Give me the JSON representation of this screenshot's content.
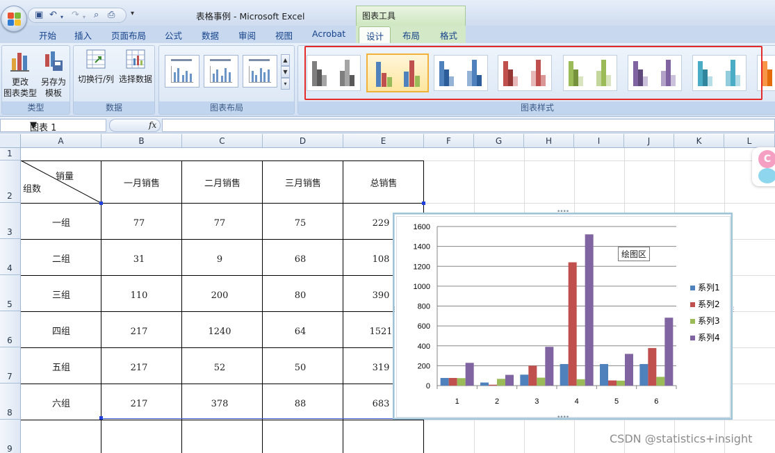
{
  "window": {
    "title": "表格事例 - Microsoft Excel",
    "context_tab_group": "图表工具"
  },
  "ribbon_tabs": [
    "开始",
    "插入",
    "页面布局",
    "公式",
    "数据",
    "审阅",
    "视图",
    "Acrobat",
    "设计",
    "布局",
    "格式"
  ],
  "active_tab": "设计",
  "ribbon_groups": {
    "type": {
      "label": "类型",
      "change_chart_type": "更改\n图表类型",
      "save_as_template": "另存为\n模板"
    },
    "data": {
      "label": "数据",
      "switch_row_col": "切换行/列",
      "select_data": "选择数据"
    },
    "layout": {
      "label": "图表布局"
    },
    "styles": {
      "label": "图表样式"
    }
  },
  "formula_bar": {
    "name_box": "图表 1",
    "fx": "fx",
    "formula": ""
  },
  "columns": [
    "A",
    "B",
    "C",
    "D",
    "E",
    "F",
    "G",
    "H",
    "I",
    "J",
    "K",
    "L"
  ],
  "rows": [
    "1",
    "2",
    "3",
    "4",
    "5",
    "6",
    "7",
    "8",
    "9"
  ],
  "table": {
    "header_diag_top": "销量",
    "header_diag_bottom": "组数",
    "headers": [
      "一月销售",
      "二月销售",
      "三月销售",
      "总销售"
    ],
    "rows": [
      {
        "group": "一组",
        "m1": "77",
        "m2": "77",
        "m3": "75",
        "total": "229"
      },
      {
        "group": "二组",
        "m1": "31",
        "m2": "9",
        "m3": "68",
        "total": "108"
      },
      {
        "group": "三组",
        "m1": "110",
        "m2": "200",
        "m3": "80",
        "total": "390"
      },
      {
        "group": "四组",
        "m1": "217",
        "m2": "1240",
        "m3": "64",
        "total": "1521"
      },
      {
        "group": "五组",
        "m1": "217",
        "m2": "52",
        "m3": "50",
        "total": "319"
      },
      {
        "group": "六组",
        "m1": "217",
        "m2": "378",
        "m3": "88",
        "total": "683"
      }
    ]
  },
  "chart_data": {
    "type": "bar",
    "categories": [
      "1",
      "2",
      "3",
      "4",
      "5",
      "6"
    ],
    "series": [
      {
        "name": "系列1",
        "color": "#4f81bd",
        "values": [
          77,
          31,
          110,
          217,
          217,
          217
        ]
      },
      {
        "name": "系列2",
        "color": "#c0504d",
        "values": [
          77,
          9,
          200,
          1240,
          52,
          378
        ]
      },
      {
        "name": "系列3",
        "color": "#9bbb59",
        "values": [
          75,
          68,
          80,
          64,
          50,
          88
        ]
      },
      {
        "name": "系列4",
        "color": "#8064a2",
        "values": [
          229,
          108,
          390,
          1521,
          319,
          683
        ]
      }
    ],
    "ylim": [
      0,
      1600
    ],
    "yticks": [
      "0",
      "200",
      "400",
      "600",
      "800",
      "1000",
      "1200",
      "1400",
      "1600"
    ],
    "grid": true,
    "legend": "right"
  },
  "chart_tooltip": "绘图区",
  "watermark": "CSDN @statistics+insight",
  "side_widget_letter": "C"
}
